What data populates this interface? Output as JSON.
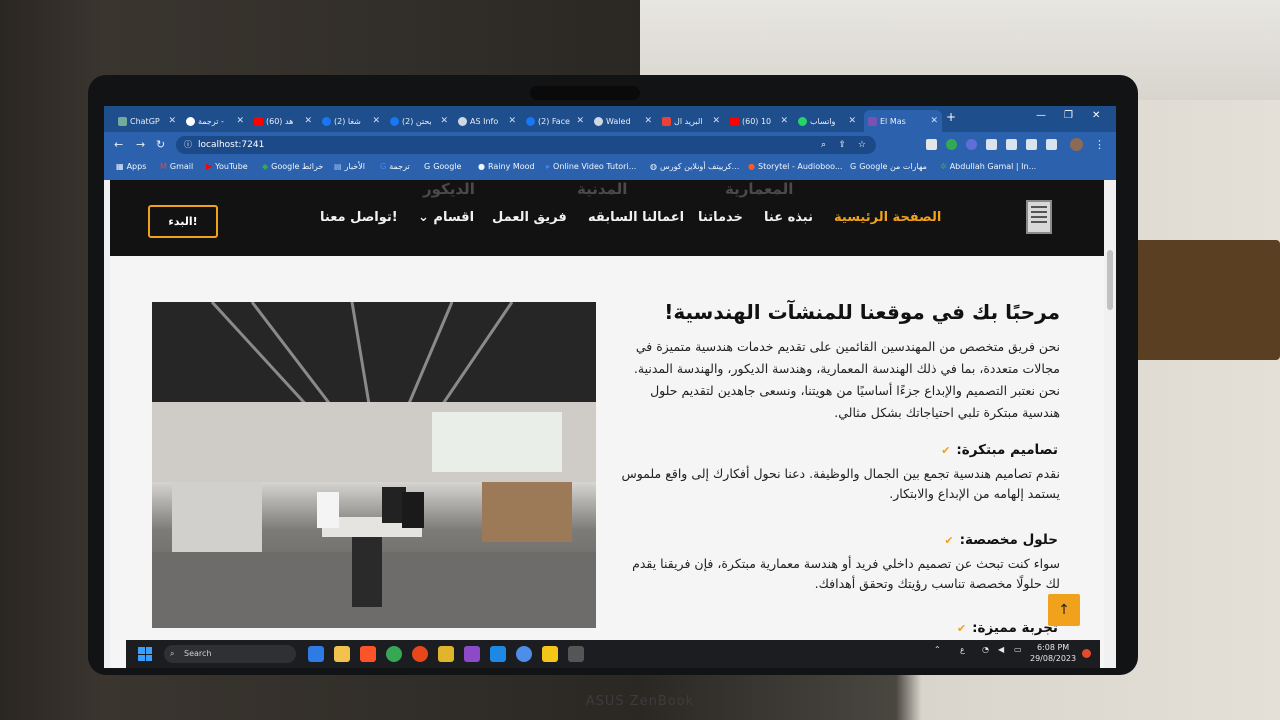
{
  "browser": {
    "tabs": [
      {
        "label": "ChatGP",
        "icon": "chatgpt-icon",
        "active": false
      },
      {
        "label": "ترجمة -",
        "icon": "google-icon",
        "active": false
      },
      {
        "label": "(60) هد",
        "icon": "youtube-icon",
        "active": false
      },
      {
        "label": "(2) شغا",
        "icon": "facebook-icon",
        "active": false
      },
      {
        "label": "(2) بحتن",
        "icon": "facebook-icon",
        "active": false
      },
      {
        "label": "AS Info",
        "icon": "globe-icon",
        "active": false
      },
      {
        "label": "(2) Face",
        "icon": "facebook-icon",
        "active": false
      },
      {
        "label": "Waled",
        "icon": "globe-icon",
        "active": false
      },
      {
        "label": "البريد ال",
        "icon": "gmail-icon",
        "active": false
      },
      {
        "label": "(60) 10",
        "icon": "youtube-icon",
        "active": false
      },
      {
        "label": "واتساب",
        "icon": "whatsapp-icon",
        "active": false
      },
      {
        "label": "El Mas",
        "icon": "bootstrap-icon",
        "active": true
      }
    ],
    "new_tab": "+",
    "address": "localhost:7241",
    "bookmarks": [
      {
        "label": "Apps",
        "icon": "apps-grid-icon"
      },
      {
        "label": "Gmail",
        "icon": "gmail-icon"
      },
      {
        "label": "YouTube",
        "icon": "youtube-icon"
      },
      {
        "label": "Google خرائط",
        "icon": "maps-icon"
      },
      {
        "label": "الأخبار",
        "icon": "news-icon"
      },
      {
        "label": "ترجمة",
        "icon": "translate-icon"
      },
      {
        "label": "Google",
        "icon": "google-icon"
      },
      {
        "label": "Rainy Mood",
        "icon": "globe-icon"
      },
      {
        "label": "Online Video Tutori...",
        "icon": "video-icon"
      },
      {
        "label": "كرييتف أونلاين كورس...",
        "icon": "globe-icon"
      },
      {
        "label": "Storytel - Audioboo...",
        "icon": "storytel-icon"
      },
      {
        "label": "Google مهارات من",
        "icon": "google-icon"
      },
      {
        "label": "Abdullah Gamal | In...",
        "icon": "leaf-icon"
      }
    ]
  },
  "site": {
    "ghost_words": [
      "الديكور",
      "المدنية",
      "المعمارية"
    ],
    "start_button": "البدء!",
    "nav": [
      {
        "label": "الصفحة الرئيسية",
        "active": true
      },
      {
        "label": "نبذه عنا",
        "active": false
      },
      {
        "label": "خدماتنا",
        "active": false
      },
      {
        "label": "اعمالنا السابقه",
        "active": false
      },
      {
        "label": "فريق العمل",
        "active": false
      },
      {
        "label": "اقسام",
        "active": false,
        "dropdown": true
      },
      {
        "label": "تواصل معنا!",
        "active": false
      }
    ],
    "hero": {
      "title": "مرحبًا بك في موقعنا للمنشآت الهندسية!",
      "paragraph": "نحن فريق متخصص من المهندسين القائمين على تقديم خدمات هندسية متميزة في مجالات متعددة، بما في ذلك الهندسة المعمارية، وهندسة الديكور، والهندسة المدنية. نحن نعتبر التصميم والإبداع جزءًا أساسيًا من هويتنا، ونسعى جاهدين لتقديم حلول هندسية مبتكرة تلبي احتياجاتك بشكل مثالي."
    },
    "features": [
      {
        "title": "تصاميم مبتكرة:",
        "text": "نقدم تصاميم هندسية تجمع بين الجمال والوظيفة. دعنا نحول أفكارك إلى واقع ملموس يستمد إلهامه من الإبداع والابتكار."
      },
      {
        "title": "حلول مخصصة:",
        "text": "سواء كنت تبحث عن تصميم داخلي فريد أو هندسة معمارية مبتكرة، فإن فريقنا يقدم لك حلولًا مخصصة تناسب رؤيتك وتحقق أهدافك."
      },
      {
        "title": "تجربة مميزة:",
        "text": ""
      }
    ],
    "scroll_top": "↑"
  },
  "taskbar": {
    "search_placeholder": "Search",
    "time": "6:08 PM",
    "date": "29/08/2023",
    "lang": "ع"
  },
  "laptop_brand": "ASUS ZenBook",
  "colors": {
    "accent": "#f0a21d",
    "nav_bg": "#121212",
    "chrome_blue": "#2c62ad"
  }
}
